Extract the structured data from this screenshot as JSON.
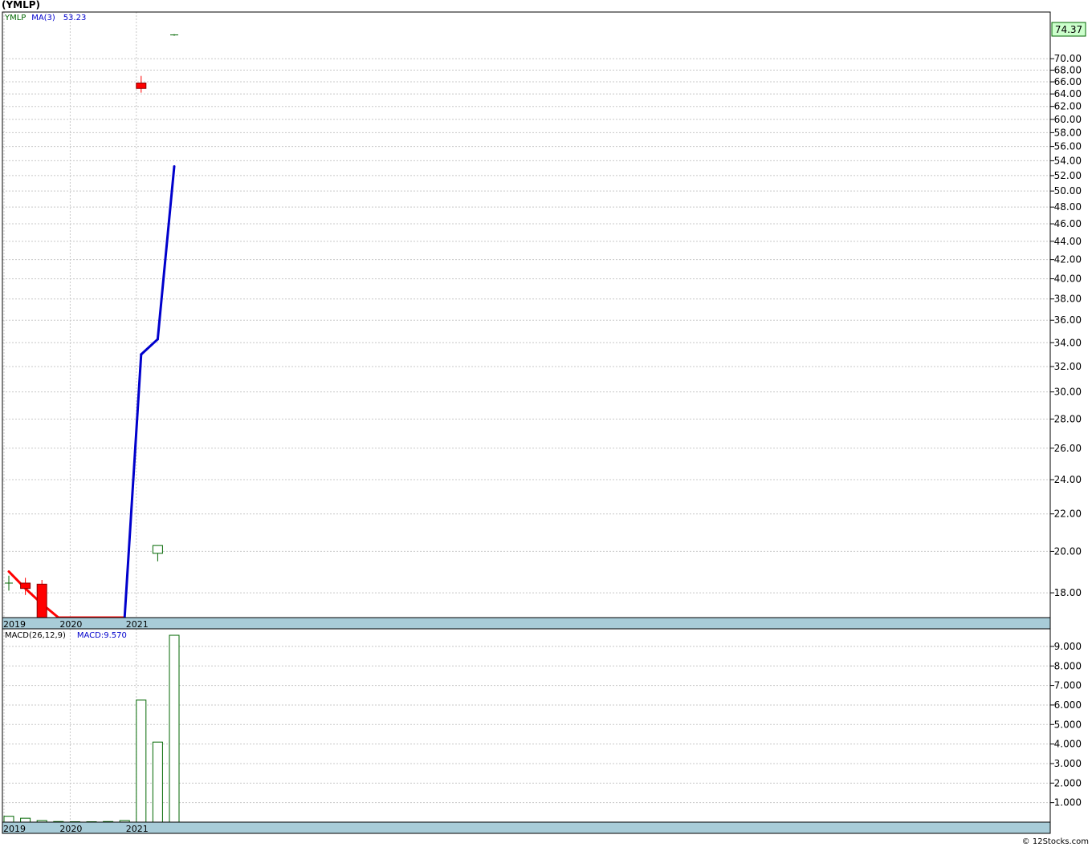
{
  "title": "(YMLP)",
  "footer": "© 12Stocks.com",
  "colors": {
    "up": "#006600",
    "down": "#ff0000",
    "ma_down": "#ff0000",
    "ma_up": "#0000cc",
    "grid": "#c8c8c8",
    "date_band": "#a8ccd8",
    "last_price_bg": "#ccffcc"
  },
  "chart_data": [
    {
      "type": "candlestick",
      "title": "",
      "legend": [
        {
          "text": "YMLP",
          "color": "#006600"
        },
        {
          "text": "MA(3)",
          "color": "#0000cc"
        },
        {
          "text": "53.23",
          "color": "#0000cc"
        }
      ],
      "last_price_label": "74.37",
      "y_ticks": [
        "18.00",
        "20.00",
        "22.00",
        "24.00",
        "26.00",
        "28.00",
        "30.00",
        "32.00",
        "34.00",
        "36.00",
        "38.00",
        "40.00",
        "42.00",
        "44.00",
        "46.00",
        "48.00",
        "50.00",
        "52.00",
        "54.00",
        "56.00",
        "58.00",
        "60.00",
        "62.00",
        "64.00",
        "66.00",
        "68.00",
        "70.00"
      ],
      "y_scale": "log",
      "ylim": [
        16.9,
        78.5
      ],
      "x_axis_labels": [
        {
          "label": "2019",
          "index": 0
        },
        {
          "label": "2020",
          "index": 4
        },
        {
          "label": "2021",
          "index": 8
        }
      ],
      "grid": true,
      "candles": [
        {
          "open": 18.45,
          "high": 18.8,
          "low": 18.1,
          "close": 18.45
        },
        {
          "open": 18.45,
          "high": 18.7,
          "low": 17.9,
          "close": 18.2
        },
        {
          "open": 18.4,
          "high": 18.6,
          "low": 16.9,
          "close": 16.9
        },
        {
          "open": 16.9,
          "high": 16.9,
          "low": 16.9,
          "close": 16.9
        },
        {
          "open": 16.9,
          "high": 16.9,
          "low": 16.9,
          "close": 16.9
        },
        {
          "open": 16.9,
          "high": 16.9,
          "low": 16.9,
          "close": 16.9
        },
        {
          "open": 16.9,
          "high": 16.9,
          "low": 16.9,
          "close": 16.9
        },
        {
          "open": 16.9,
          "high": 16.9,
          "low": 16.9,
          "close": 16.9
        },
        {
          "open": 65.8,
          "high": 67.0,
          "low": 64.2,
          "close": 64.9
        },
        {
          "open": 19.9,
          "high": 20.3,
          "low": 19.5,
          "close": 20.3
        },
        {
          "open": 74.37,
          "high": 74.5,
          "low": 74.2,
          "close": 74.37
        }
      ],
      "ma": {
        "name": "MA(3)",
        "values": [
          19.0,
          18.2,
          17.5,
          16.9,
          16.9,
          16.9,
          16.9,
          16.9,
          33.0,
          34.3,
          53.23
        ]
      }
    },
    {
      "type": "bar",
      "title": "",
      "legend": [
        {
          "text": "MACD(26,12,9)",
          "color": "#000000"
        },
        {
          "text": "MACD:9.570",
          "color": "#0000cc"
        }
      ],
      "y_ticks": [
        "1.000",
        "2.000",
        "3.000",
        "4.000",
        "5.000",
        "6.000",
        "7.000",
        "8.000",
        "9.000"
      ],
      "ylim": [
        0,
        9.9
      ],
      "grid": true,
      "x_axis_labels": [
        {
          "label": "2019",
          "index": 0
        },
        {
          "label": "2020",
          "index": 4
        },
        {
          "label": "2021",
          "index": 8
        }
      ],
      "values": [
        0.3,
        0.2,
        0.08,
        0.03,
        0.0,
        0.0,
        0.03,
        0.08,
        6.25,
        4.1,
        9.57
      ]
    }
  ]
}
